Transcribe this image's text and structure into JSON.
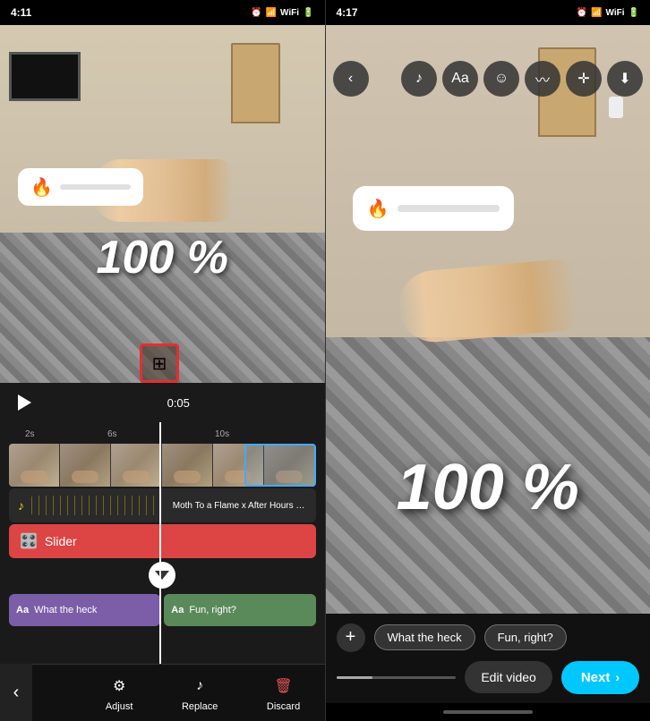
{
  "left": {
    "status_time": "4:11",
    "status_icons": "🔋",
    "playback_time": "0:05",
    "audio_label": "Moth To a Flame x After Hours (TikTok Edit) (Remix) - Xanem...",
    "slider_label": "Slider",
    "text_clip_1": "What the heck",
    "text_clip_2": "Fun, right?",
    "toolbar_adjust": "Adjust",
    "toolbar_replace": "Replace",
    "toolbar_discard": "Discard",
    "hundred_percent": "100 %"
  },
  "right": {
    "status_time": "4:17",
    "hundred_percent": "100 %",
    "chip_1": "What the heck",
    "chip_2": "Fun, right?",
    "edit_video_label": "Edit video",
    "next_label": "Next"
  },
  "icons": {
    "play": "▶",
    "music_note": "♪",
    "fire": "🔥",
    "slider_icon": "🎛️",
    "aa_text": "Aa",
    "chevron_left": "‹",
    "chevron_right": "›",
    "back": "←",
    "plus": "+",
    "bars": "⊞",
    "adjust": "⚙",
    "replace": "♪",
    "discard": "🗑",
    "music_toolbar": "♫",
    "sticker": "☺",
    "effects": "✦",
    "move": "✛",
    "download": "⬇"
  }
}
